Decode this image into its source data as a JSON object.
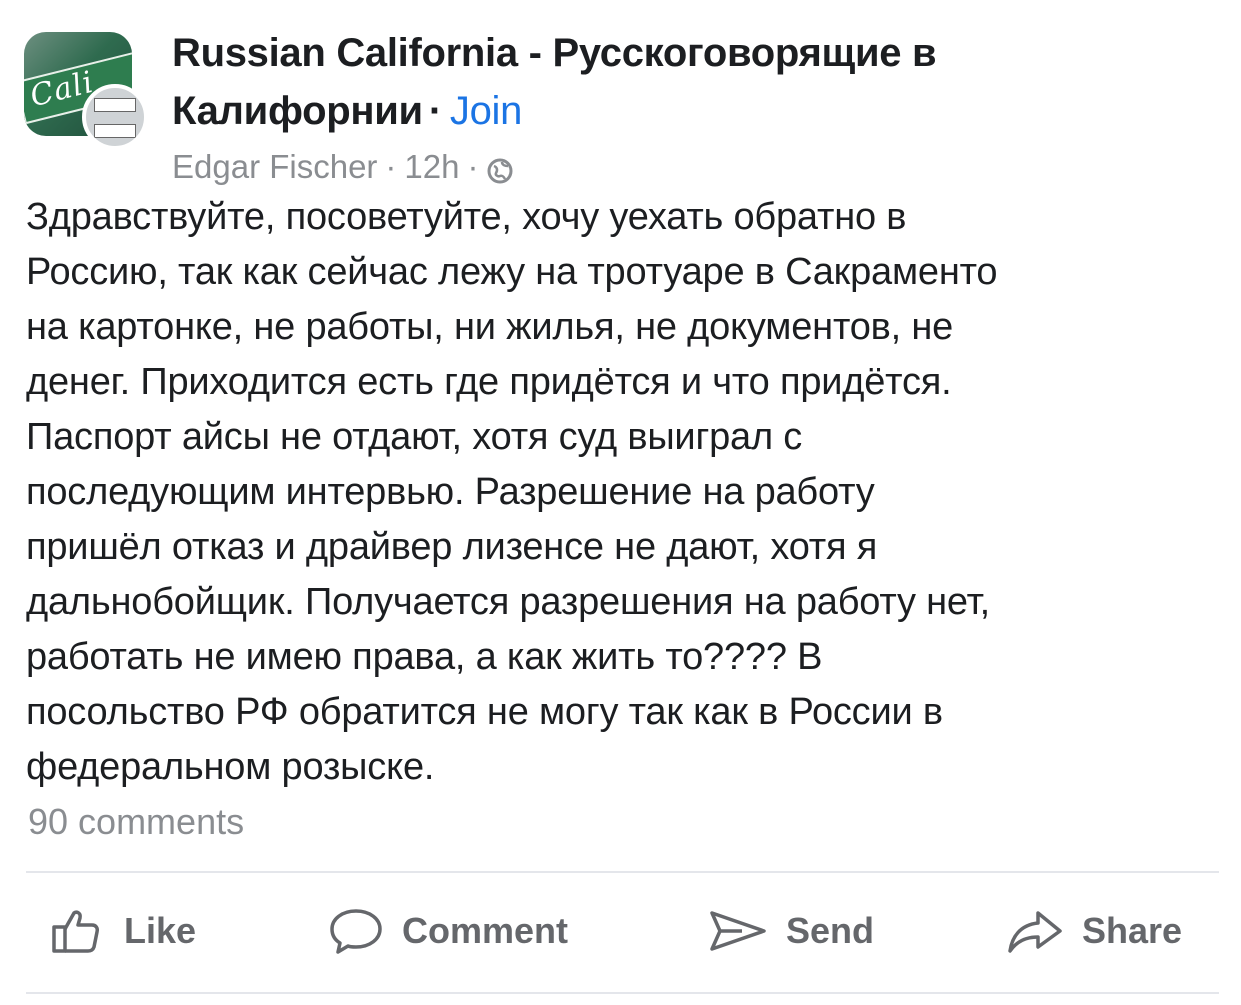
{
  "post": {
    "group_name": "Russian California - Русскоговорящие в Калифорнии",
    "separator": "·",
    "join_label": "Join",
    "author": "Edgar Fischer",
    "time": "12h",
    "privacy_icon": "globe-icon",
    "text": "Здравствуйте, посоветуйте, хочу уехать обратно в\nРоссию, так как сейчас лежу на тротуаре в Сакраменто\nна картонке, не работы, ни жилья, не документов, не\nденег. Приходится есть где придётся и что придётся.\nПаспорт айсы не отдают, хотя суд выиграл с\nпоследующим интервью. Разрешение на работу\nпришёл отказ и драйвер лизенсе не дают, хотя я\nдальнобойщик. Получается разрешения на работу нет,\nработать не имею права, а как жить то???? В\nпосольство РФ обратится не могу так как в России в\nфедеральном розыске.",
    "comments_count": "90 comments"
  },
  "actions": {
    "like_label": "Like",
    "comment_label": "Comment",
    "send_label": "Send",
    "share_label": "Share"
  },
  "colors": {
    "text": "#1c1e21",
    "secondary": "#8a8d91",
    "action": "#65676b",
    "link": "#1b74e4",
    "divider": "#e4e6eb"
  }
}
